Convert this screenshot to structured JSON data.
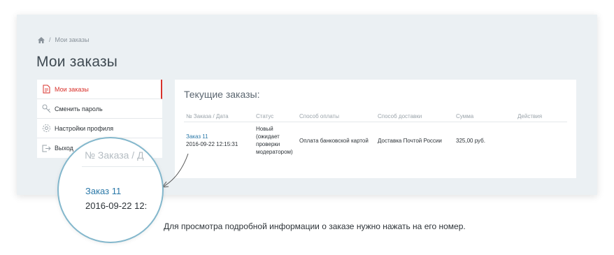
{
  "breadcrumb": {
    "current": "Мои заказы",
    "separator": "/"
  },
  "page_title": "Мои заказы",
  "sidebar": {
    "items": [
      {
        "label": "Мои заказы",
        "icon": "document-icon",
        "active": true
      },
      {
        "label": "Сменить пароль",
        "icon": "key-icon",
        "active": false
      },
      {
        "label": "Настройки профиля",
        "icon": "gear-icon",
        "active": false
      },
      {
        "label": "Выход",
        "icon": "logout-icon",
        "active": false
      }
    ]
  },
  "orders": {
    "title": "Текущие заказы:",
    "columns": [
      "№ Заказа / Дата",
      "Статус",
      "Способ оплаты",
      "Способ доставки",
      "Сумма",
      "Действия"
    ],
    "rows": [
      {
        "order": "Заказ 11",
        "date": "2016-09-22 12:15:31",
        "status": [
          "Новый",
          "(ожидает",
          "проверки",
          "модератором)"
        ],
        "payment": "Оплата банковской картой",
        "delivery": "Доставка Почтой России",
        "amount": "325,00 руб.",
        "actions": ""
      }
    ]
  },
  "zoom": {
    "header": "№ Заказа / Д",
    "order": "Заказ 11",
    "date": "2016-09-22 12:"
  },
  "caption": "Для просмотра подробной информации о заказе нужно нажать на его номер.",
  "colors": {
    "accent_red": "#d8312b",
    "link_blue": "#2a78a8",
    "panel_bg": "#ebf0f3",
    "zoom_border": "#83b7cc"
  }
}
